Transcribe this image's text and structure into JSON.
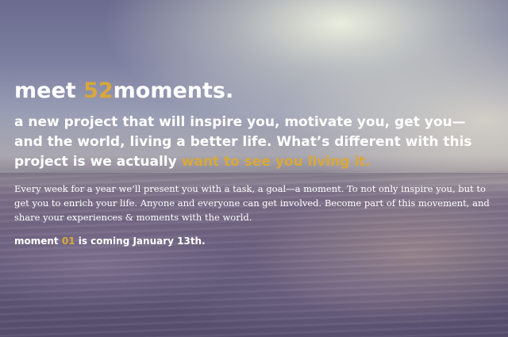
{
  "heading": {
    "prefix": "meet ",
    "number": "52",
    "suffix": "moments."
  },
  "lede": {
    "text": "a new project that will inspire you, motivate you, get you—and the world, living a better life. What’s different with this project is we actually ",
    "highlight": "want to see you living it."
  },
  "body": {
    "text": "Every week for a year we’ll present you with a task, a goal—a moment. To not only inspire you, but to get you to enrich your life. Anyone and everyone can get involved. Become part of this movement, and share your experiences & moments with the world."
  },
  "announcement": {
    "prefix": "moment ",
    "number": "01",
    "suffix": " is coming January 13th."
  },
  "colors": {
    "accent": "#d9a83a",
    "text": "#ffffff"
  }
}
